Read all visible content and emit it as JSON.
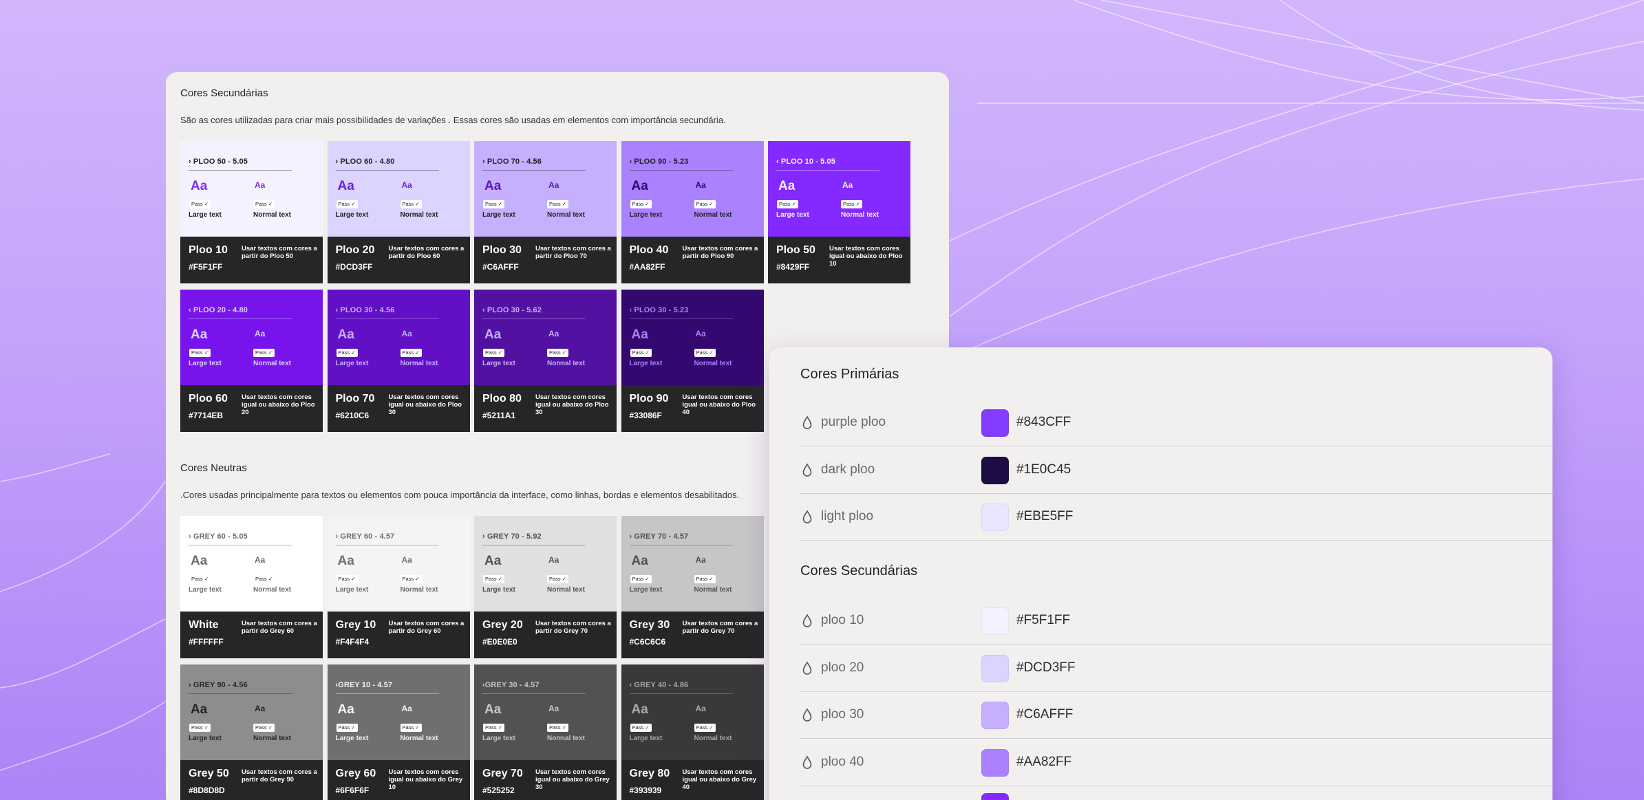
{
  "secondary_section": {
    "title": "Cores Secundárias",
    "description": "São as cores utilizadas para criar mais possibilidades de variações . Essas cores são usadas em elementos com importância secundária.",
    "swatches": [
      {
        "ratio": "› PLOO 50 - 5.05",
        "aa": "Aa",
        "pass": "Pass ✓",
        "large": "Large text",
        "normal": "Normal text",
        "name": "Ploo 10",
        "hex": "#F5F1FF",
        "use": "Usar textos com cores a partir do Ploo 50",
        "bg": "#F5F1FF",
        "fg": "#7C2CF2",
        "lbl": "#222222"
      },
      {
        "ratio": "› PLOO 60 - 4.80",
        "aa": "Aa",
        "pass": "Pass ✓",
        "large": "Large text",
        "normal": "Normal text",
        "name": "Ploo 20",
        "hex": "#DCD3FF",
        "use": "Usar textos com cores a partir do Ploo 60",
        "bg": "#DCD3FF",
        "fg": "#6C1FE0",
        "lbl": "#222222"
      },
      {
        "ratio": "› PLOO 70 - 4.56",
        "aa": "Aa",
        "pass": "Pass ✓",
        "large": "Large text",
        "normal": "Normal text",
        "name": "Ploo 30",
        "hex": "#C6AFFF",
        "use": "Usar textos com cores a partir do Ploo 70",
        "bg": "#C6AFFF",
        "fg": "#5A14C2",
        "lbl": "#222222"
      },
      {
        "ratio": "› PLOO 90 - 5.23",
        "aa": "Aa",
        "pass": "Pass ✓",
        "large": "Large text",
        "normal": "Normal text",
        "name": "Ploo 40",
        "hex": "#AA82FF",
        "use": "Usar textos com cores a partir do Ploo 90",
        "bg": "#AA82FF",
        "fg": "#33086F",
        "lbl": "#222222"
      },
      {
        "ratio": "‹ PLOO 10 - 5.05",
        "aa": "Aa",
        "pass": "Pass ✓",
        "large": "Large text",
        "normal": "Normal text",
        "name": "Ploo 50",
        "hex": "#8429FF",
        "use": "Usar textos com cores igual ou abaixo do Ploo 10",
        "bg": "#8429FF",
        "fg": "#F5F1FF",
        "lbl": "#F5F1FF"
      },
      {
        "ratio": "‹ PLOO 20 - 4.80",
        "aa": "Aa",
        "pass": "Pass ✓",
        "large": "Large text",
        "normal": "Normal text",
        "name": "Ploo 60",
        "hex": "#7714EB",
        "use": "Usar textos com cores igual ou abaixo do Ploo 20",
        "bg": "#7714EB",
        "fg": "#DCD3FF",
        "lbl": "#DCD3FF"
      },
      {
        "ratio": "‹ PLOO 30 - 4.56",
        "aa": "Aa",
        "pass": "Pass ✓",
        "large": "Large text",
        "normal": "Normal text",
        "name": "Ploo 70",
        "hex": "#6210C6",
        "use": "Usar textos com cores igual ou abaixo do Ploo 30",
        "bg": "#6210C6",
        "fg": "#C6AFFF",
        "lbl": "#C6AFFF"
      },
      {
        "ratio": "‹ PLOO 30 - 5.62",
        "aa": "Aa",
        "pass": "Pass ✓",
        "large": "Large text",
        "normal": "Normal text",
        "name": "Ploo 80",
        "hex": "#5211A1",
        "use": "Usar textos com cores igual ou abaixo do Ploo 30",
        "bg": "#5211A1",
        "fg": "#C6AFFF",
        "lbl": "#C6AFFF"
      },
      {
        "ratio": "‹ PLOO 30 - 5.23",
        "aa": "Aa",
        "pass": "Pass ✓",
        "large": "Large text",
        "normal": "Normal text",
        "name": "Ploo 90",
        "hex": "#33086F",
        "use": "Usar textos com cores igual ou abaixo do Ploo 40",
        "bg": "#33086F",
        "fg": "#AA82FF",
        "lbl": "#AA82FF"
      }
    ]
  },
  "neutral_section": {
    "title": "Cores Neutras",
    "description": ".Cores usadas principalmente para textos ou elementos com pouca importância da interface, como linhas, bordas e elementos desabilitados.",
    "swatches": [
      {
        "ratio": "› GREY 60 - 5.05",
        "aa": "Aa",
        "pass": "Pass ✓",
        "large": "Large text",
        "normal": "Normal text",
        "name": "White",
        "hex": "#FFFFFF",
        "use": "Usar textos com cores a partir do Grey 60",
        "bg": "#FFFFFF",
        "fg": "#6F6F6F",
        "lbl": "#6F6F6F"
      },
      {
        "ratio": "› GREY 60 - 4.57",
        "aa": "Aa",
        "pass": "Pass ✓",
        "large": "Large text",
        "normal": "Normal text",
        "name": "Grey 10",
        "hex": "#F4F4F4",
        "use": "Usar textos com cores a partir do Grey 60",
        "bg": "#F4F4F4",
        "fg": "#6F6F6F",
        "lbl": "#6F6F6F"
      },
      {
        "ratio": "› GREY 70 - 5.92",
        "aa": "Aa",
        "pass": "Pass ✓",
        "large": "Large text",
        "normal": "Normal text",
        "name": "Grey 20",
        "hex": "#E0E0E0",
        "use": "Usar textos com cores a partir do Grey 70",
        "bg": "#E0E0E0",
        "fg": "#525252",
        "lbl": "#525252"
      },
      {
        "ratio": "› GREY 70 - 4.57",
        "aa": "Aa",
        "pass": "Pass ✓",
        "large": "Large text",
        "normal": "Normal text",
        "name": "Grey 30",
        "hex": "#C6C6C6",
        "use": "Usar textos com cores a partir do Grey 70",
        "bg": "#C6C6C6",
        "fg": "#525252",
        "lbl": "#525252"
      },
      {
        "ratio": "› GREY 90 - 4.56",
        "aa": "Aa",
        "pass": "Pass ✓",
        "large": "Large text",
        "normal": "Normal text",
        "name": "Grey 50",
        "hex": "#8D8D8D",
        "use": "Usar textos com cores a partir do Grey 90",
        "bg": "#8D8D8D",
        "fg": "#262626",
        "lbl": "#262626"
      },
      {
        "ratio": "‹GREY 10 - 4.57",
        "aa": "Aa",
        "pass": "Pass ✓",
        "large": "Large text",
        "normal": "Normal text",
        "name": "Grey 60",
        "hex": "#6F6F6F",
        "use": "Usar textos com cores igual ou abaixo do Grey 10",
        "bg": "#6F6F6F",
        "fg": "#F4F4F4",
        "lbl": "#F4F4F4"
      },
      {
        "ratio": "‹GREY 30 - 4.57",
        "aa": "Aa",
        "pass": "Pass ✓",
        "large": "Large text",
        "normal": "Normal text",
        "name": "Grey 70",
        "hex": "#525252",
        "use": "Usar textos com cores igual ou abaixo do Grey 30",
        "bg": "#525252",
        "fg": "#C6C6C6",
        "lbl": "#C6C6C6"
      },
      {
        "ratio": "‹ GREY 40 - 4.86",
        "aa": "Aa",
        "pass": "Pass ✓",
        "large": "Large text",
        "normal": "Normal text",
        "name": "Grey 80",
        "hex": "#393939",
        "use": "Usar textos com cores igual ou abaixo do Grey 40",
        "bg": "#393939",
        "fg": "#A8A8A8",
        "lbl": "#A8A8A8"
      }
    ]
  },
  "tokens_panel": {
    "primary_title": "Cores Primárias",
    "primary": [
      {
        "name": "purple ploo",
        "hex": "#843CFF",
        "color": "#843CFF",
        "icon": "drop-icon"
      },
      {
        "name": "dark ploo",
        "hex": "#1E0C45",
        "color": "#1E0C45",
        "icon": "drop-icon"
      },
      {
        "name": "light ploo",
        "hex": "#EBE5FF",
        "color": "#EBE5FF",
        "icon": "drop-icon"
      }
    ],
    "secondary_title": "Cores Secundárias",
    "secondary": [
      {
        "name": "ploo 10",
        "hex": "#F5F1FF",
        "color": "#F5F1FF",
        "icon": "drop-icon"
      },
      {
        "name": "ploo 20",
        "hex": "#DCD3FF",
        "color": "#DCD3FF",
        "icon": "drop-icon"
      },
      {
        "name": "ploo 30",
        "hex": "#C6AFFF",
        "color": "#C6AFFF",
        "icon": "drop-icon"
      },
      {
        "name": "ploo 40",
        "hex": "#AA82FF",
        "color": "#AA82FF",
        "icon": "drop-icon"
      }
    ],
    "partial_chip_color": "#8429FF"
  },
  "colors": {
    "background": "#C3A2FB",
    "panel": "#F2F0EF",
    "swatch_footer": "#262626"
  }
}
